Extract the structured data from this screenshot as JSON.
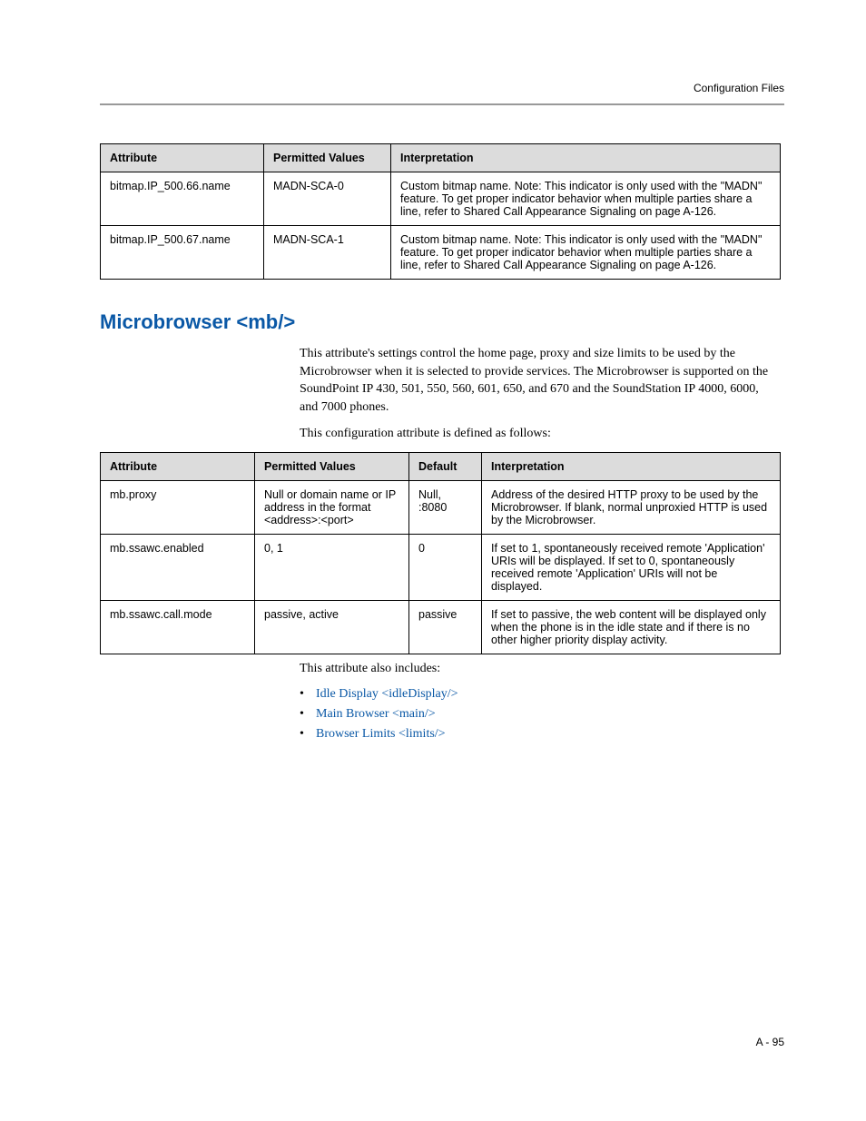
{
  "header": {
    "running_head": "Configuration Files"
  },
  "table1": {
    "headers": [
      "Attribute",
      "Permitted Values",
      "Interpretation"
    ],
    "rows": [
      {
        "attribute": "bitmap.IP_500.66.name",
        "permitted": "MADN-SCA-0",
        "interpretation": "Custom bitmap name.\nNote: This indicator is only used with the \"MADN\" feature. To get proper indicator behavior when multiple parties share a line, refer to Shared Call Appearance Signaling on page A-126."
      },
      {
        "attribute": "bitmap.IP_500.67.name",
        "permitted": "MADN-SCA-1",
        "interpretation": "Custom bitmap name.\nNote: This indicator is only used with the \"MADN\" feature. To get proper indicator behavior when multiple parties share a line, refer to Shared Call Appearance Signaling on page A-126."
      }
    ]
  },
  "section": {
    "title": "Microbrowser <mb/>",
    "para1": "This attribute's settings control the home page, proxy and size limits to be used by the Microbrowser when it is selected to provide services. The Microbrowser is supported on the SoundPoint IP 430, 501, 550, 560, 601, 650, and 670 and the SoundStation IP 4000, 6000, and 7000 phones.",
    "para2": "This configuration attribute is defined as follows:",
    "para3": "This attribute also includes:"
  },
  "table2": {
    "headers": [
      "Attribute",
      "Permitted Values",
      "Default",
      "Interpretation"
    ],
    "rows": [
      {
        "attribute": "mb.proxy",
        "permitted": "Null or domain name or IP address in the format <address>:<port>",
        "default": "Null, :8080",
        "interpretation": "Address of the desired HTTP proxy to be used by the Microbrowser. If blank, normal unproxied HTTP is used by the Microbrowser."
      },
      {
        "attribute": "mb.ssawc.enabled",
        "permitted": "0, 1",
        "default": "0",
        "interpretation": "If set to 1, spontaneously received remote 'Application' URIs will be displayed. If set to 0, spontaneously received remote 'Application' URIs will not be displayed."
      },
      {
        "attribute": "mb.ssawc.call.mode",
        "permitted": "passive, active",
        "default": "passive",
        "interpretation": "If set to passive, the web content will be displayed only when the phone is in the idle state and if there is no other higher priority display activity."
      }
    ]
  },
  "links": [
    "Idle Display <idleDisplay/>",
    "Main Browser <main/>",
    "Browser Limits <limits/>"
  ],
  "footer": {
    "page": "A - 95"
  }
}
